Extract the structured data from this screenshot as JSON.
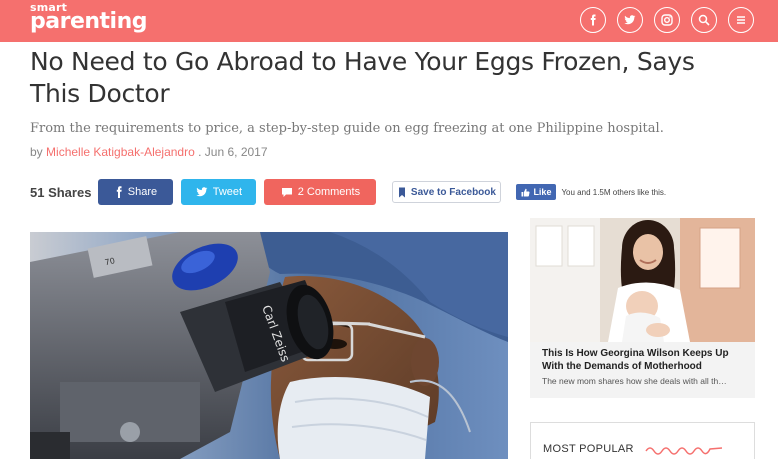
{
  "header": {
    "logo_small": "smart",
    "logo_big": "parenting",
    "bg_color": "#f5706e",
    "icons": [
      "facebook-icon",
      "twitter-icon",
      "instagram-icon",
      "search-icon",
      "menu-icon"
    ]
  },
  "article": {
    "title": "No Need to Go Abroad to Have Your Eggs Frozen, Says This Doctor",
    "subtitle": "From the requirements to price, a step-by-step guide on egg freezing at one Philippine hospital.",
    "byline_prefix": "by",
    "author": "Michelle Katigbak-Alejandro",
    "date": ". Jun 6, 2017"
  },
  "share": {
    "count": "51 Shares",
    "facebook_label": "Share",
    "twitter_label": "Tweet",
    "comments_label": "2 Comments",
    "save_label": "Save to Facebook",
    "like_label": "Like",
    "like_text": "You and 1.5M others like this.",
    "colors": {
      "facebook": "#3b5998",
      "twitter": "#2fb5ec",
      "comments": "#f0655e"
    }
  },
  "hero": {
    "lens_text": "Carl Zeiss",
    "dial_text": "70"
  },
  "sidebar": {
    "card_title": "This Is How Georgina Wilson Keeps Up With the Demands of Motherhood",
    "card_desc": "The new mom shares how she deals with all th…",
    "popular_title": "MOST POPULAR"
  }
}
